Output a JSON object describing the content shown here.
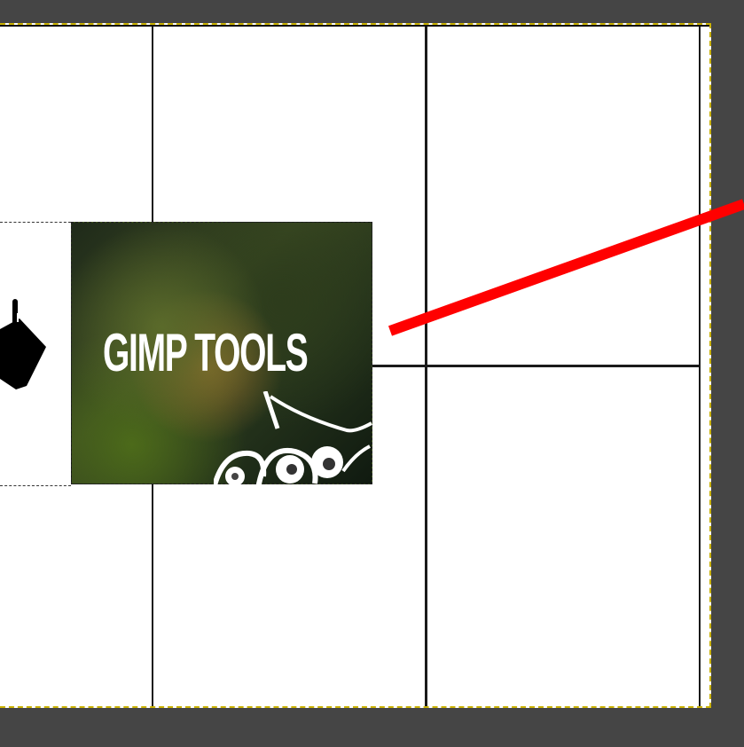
{
  "canvas": {
    "layer_thumbnail_text": "GIMP TOOLS"
  },
  "icons": {
    "bucket": "paint-bucket-icon",
    "mascot": "wilber-mascot-icon"
  },
  "colors": {
    "workspace_bg": "#454545",
    "canvas_bg": "#ffffff",
    "canvas_border": "#c9b100",
    "annotation_arrow": "#ff0000"
  }
}
